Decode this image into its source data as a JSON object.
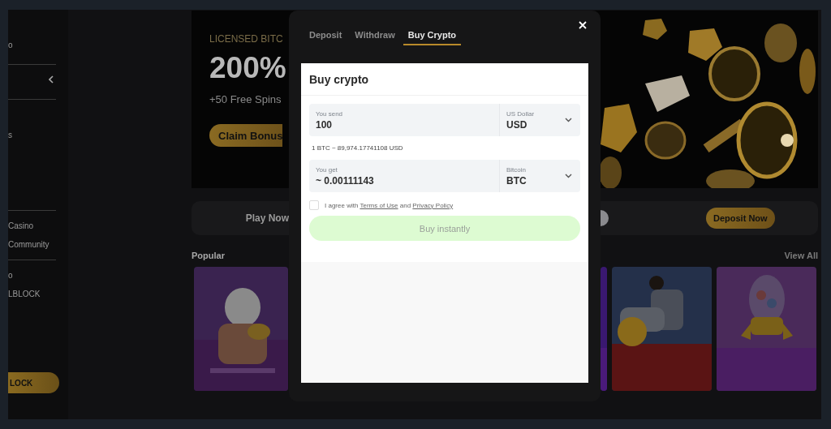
{
  "sidebar": {
    "sections": [
      {
        "kind": "links",
        "items": [
          "o"
        ]
      },
      {
        "kind": "toggle"
      },
      {
        "kind": "links",
        "items": [
          "s"
        ]
      },
      {
        "kind": "links",
        "items": [
          "Casino",
          "Community"
        ]
      },
      {
        "kind": "links",
        "items": [
          "o",
          "LBLOCK"
        ]
      }
    ],
    "button": "LOCK"
  },
  "banner": {
    "eyebrow": "LICENSED BITC",
    "headline": "200%",
    "subline": "+50 Free Spins",
    "button": "Claim Bonus"
  },
  "promo_bar": {
    "label": "Play Now",
    "button": "Deposit Now"
  },
  "popular": {
    "title": "Popular",
    "link": "View All"
  },
  "modal": {
    "tabs": [
      {
        "label": "Deposit",
        "selected": false
      },
      {
        "label": "Withdraw",
        "selected": false
      },
      {
        "label": "Buy Crypto",
        "selected": true
      }
    ],
    "title": "Buy crypto",
    "send": {
      "label": "You send",
      "value": "100",
      "currency_label": "US Dollar",
      "currency": "USD"
    },
    "rate": "1 BTC ~ 89,974.17741108 USD",
    "get": {
      "label": "You get",
      "value": "~ 0.00111143",
      "currency_label": "Bitcoin",
      "currency": "BTC"
    },
    "agreement": {
      "checked": false,
      "prefix": "I agree with",
      "terms_link": "Terms of Use",
      "joiner": "and",
      "privacy_link": "Privacy Policy"
    },
    "buy_button": {
      "label": "Buy instantly",
      "disabled": true
    }
  }
}
